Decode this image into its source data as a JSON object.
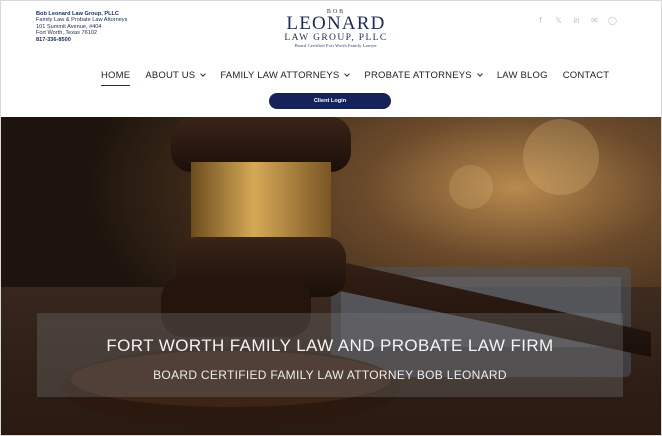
{
  "contact": {
    "firm_name": "Bob Leonard Law Group, PLLC",
    "practice": "Family Law & Probate Law Attorneys",
    "street": "101 Summit Avenue, #404",
    "city": "Fort Worth, Texas 76102",
    "phone": "817-336-8500"
  },
  "logo": {
    "first": "BOB",
    "last": "LEONARD",
    "group": "LAW GROUP, PLLC",
    "tagline": "Board Certified Fort Worth Family Lawyer"
  },
  "social": [
    {
      "icon": "facebook-icon",
      "glyph": "f"
    },
    {
      "icon": "x-icon",
      "glyph": "𝕏"
    },
    {
      "icon": "linkedin-icon",
      "glyph": "in"
    },
    {
      "icon": "mail-icon",
      "glyph": "✉"
    },
    {
      "icon": "whatsapp-icon",
      "glyph": "◯"
    }
  ],
  "nav": {
    "home": "HOME",
    "about": "ABOUT US",
    "family": "FAMILY LAW ATTORNEYS",
    "probate": "PROBATE ATTORNEYS",
    "blog": "LAW BLOG",
    "contact": "CONTACT"
  },
  "client_login": "Client Login",
  "hero": {
    "title": "FORT WORTH FAMILY LAW AND PROBATE LAW FIRM",
    "subtitle": "BOARD CERTIFIED FAMILY LAW ATTORNEY BOB LEONARD"
  },
  "colors": {
    "brand_navy": "#16235a",
    "text_navy": "#1c2b5a"
  }
}
